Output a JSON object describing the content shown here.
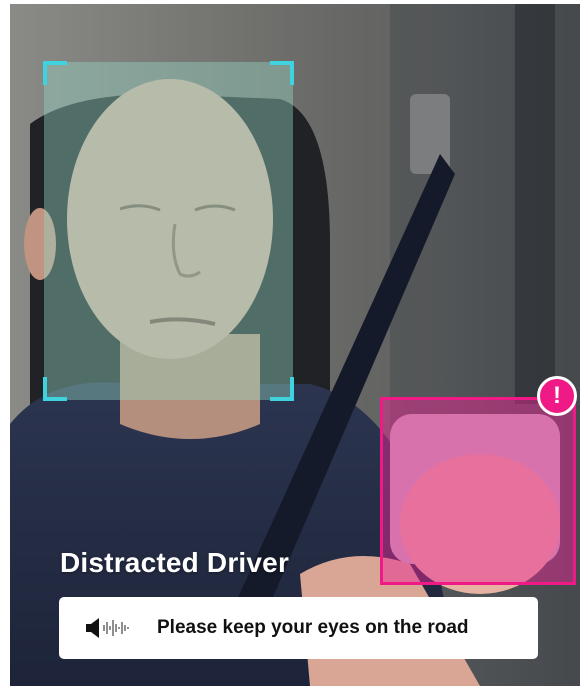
{
  "overlay": {
    "status_title": "Distracted Driver",
    "alert_message": "Please keep your eyes on the road",
    "alert_badge": "!"
  },
  "detections": {
    "face": {
      "label": "face-detection"
    },
    "phone": {
      "label": "phone-detection"
    }
  },
  "icons": {
    "audio": "speaker-waveform-icon",
    "alert": "exclamation-badge-icon"
  },
  "colors": {
    "face_box_fill": "#96d6c4",
    "face_box_corners": "#3fd3e0",
    "phone_box": "#ef1a85",
    "alert_card_bg": "#ffffff",
    "title_text": "#ffffff"
  }
}
